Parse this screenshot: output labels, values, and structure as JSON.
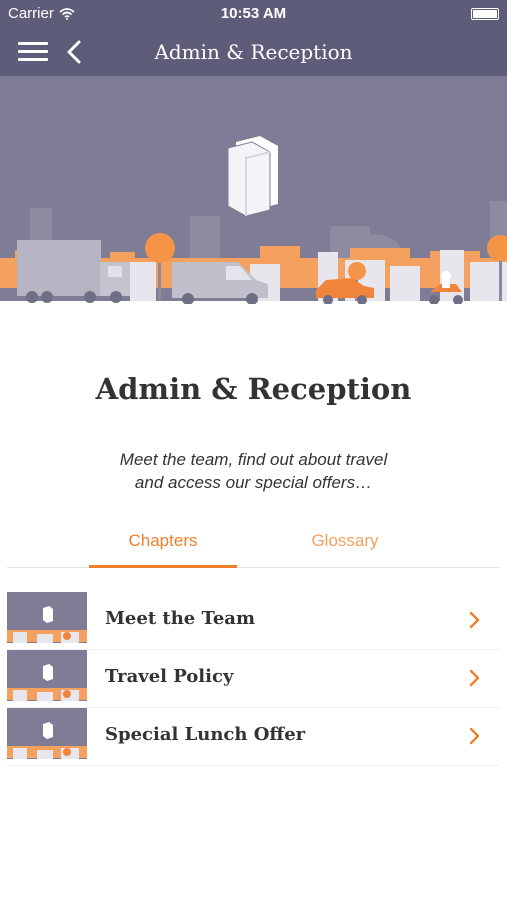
{
  "status_bar": {
    "carrier": "Carrier",
    "time": "10:53 AM",
    "wifi_icon": "wifi-icon",
    "battery_icon": "battery-icon"
  },
  "nav": {
    "title": "Admin & Reception",
    "menu_icon": "hamburger-menu-icon",
    "back_icon": "chevron-left-icon"
  },
  "hero": {
    "icon": "book-icon",
    "illustration": "city street with truck, van, car and scooter"
  },
  "page": {
    "title": "Admin & Reception",
    "subtitle_line1": "Meet the team, find out about travel",
    "subtitle_line2": "and access our special offers…"
  },
  "tabs": [
    {
      "label": "Chapters",
      "active": true
    },
    {
      "label": "Glossary",
      "active": false
    }
  ],
  "chapters": [
    {
      "label": "Meet the Team"
    },
    {
      "label": "Travel Policy"
    },
    {
      "label": "Special Lunch Offer"
    }
  ],
  "colors": {
    "nav_bg": "#5d5d7a",
    "hero_bg": "#7e7d95",
    "accent": "#f07f2b",
    "text": "#333333"
  }
}
